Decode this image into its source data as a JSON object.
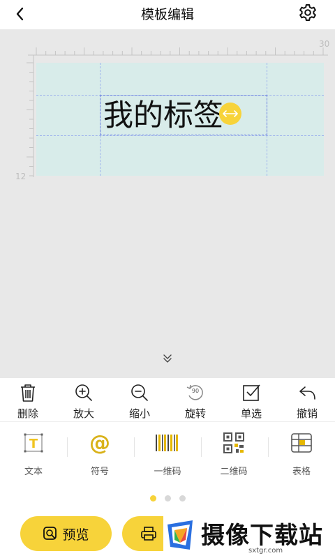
{
  "header": {
    "title": "模板编辑",
    "back_icon": "chevron-left-icon",
    "settings_icon": "gear-icon"
  },
  "canvas": {
    "ruler_top_end": "30",
    "ruler_left_end": "12",
    "label_text": "我的标签",
    "paper_color": "#d8ecea",
    "accent_color": "#f7d33a"
  },
  "toolbar": {
    "items": [
      {
        "label": "删除",
        "icon": "trash-icon"
      },
      {
        "label": "放大",
        "icon": "zoom-in-icon"
      },
      {
        "label": "缩小",
        "icon": "zoom-out-icon"
      },
      {
        "label": "旋转",
        "icon": "rotate-90-icon"
      },
      {
        "label": "单选",
        "icon": "checkbox-icon"
      },
      {
        "label": "撤销",
        "icon": "undo-icon"
      }
    ],
    "rotate_badge": "90"
  },
  "elements": {
    "items": [
      {
        "label": "文本",
        "icon": "text-icon"
      },
      {
        "label": "符号",
        "icon": "at-symbol-icon"
      },
      {
        "label": "一维码",
        "icon": "barcode-icon"
      },
      {
        "label": "二维码",
        "icon": "qrcode-icon"
      },
      {
        "label": "表格",
        "icon": "table-icon"
      }
    ],
    "text_glyph": "T",
    "symbol_glyph": "@"
  },
  "pager": {
    "pages": 3,
    "active": 1
  },
  "actions": {
    "preview_label": "预览",
    "preview_icon": "preview-icon",
    "print_icon": "printer-icon"
  },
  "watermark": {
    "text": "摄像下载站",
    "url": "sxtgr.com"
  }
}
